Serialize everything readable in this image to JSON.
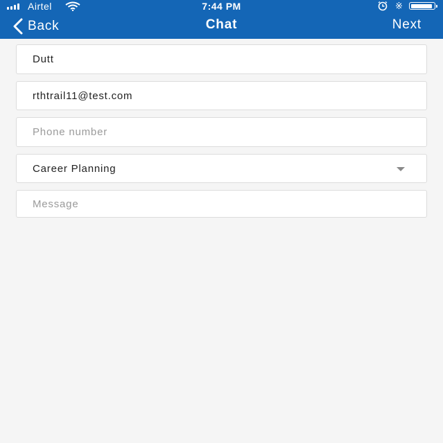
{
  "status_bar": {
    "carrier": "Airtel",
    "time": "7:44 PM",
    "signal_bars": 4,
    "battery_level": 0.95,
    "icons": [
      "signal-icon",
      "wifi-icon",
      "alarm-icon",
      "bluetooth-icon",
      "battery-icon"
    ]
  },
  "nav": {
    "back_label": "Back",
    "title": "Chat",
    "next_label": "Next",
    "bar_color": "#1466b6"
  },
  "form": {
    "name_value": "Dutt",
    "email_value": "rthtrail11@test.com",
    "phone_placeholder": "Phone number",
    "topic_value": "Career Planning",
    "message_placeholder": "Message"
  }
}
